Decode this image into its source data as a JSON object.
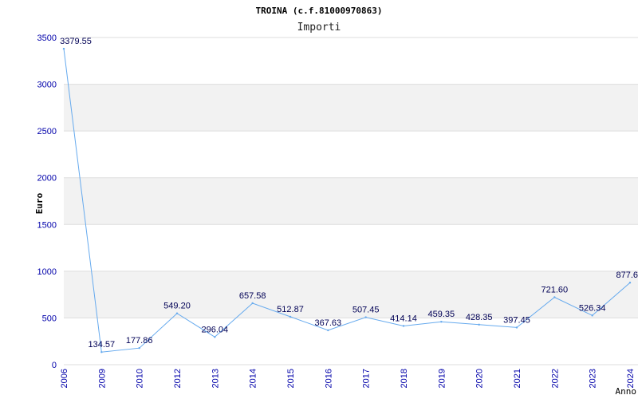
{
  "chart_data": {
    "type": "line",
    "title": "TROINA (c.f.81000970863)",
    "subtitle": "Importi",
    "ylabel": "Euro",
    "xlabel": "Anno",
    "ylim": [
      0,
      3500
    ],
    "y_ticks": [
      "0",
      "500",
      "1000",
      "1500",
      "2000",
      "2500",
      "3000",
      "3500"
    ],
    "grid": "horizontal bands",
    "categories": [
      "2006",
      "2009",
      "2010",
      "2012",
      "2013",
      "2014",
      "2015",
      "2016",
      "2017",
      "2018",
      "2019",
      "2020",
      "2021",
      "2022",
      "2023",
      "2024"
    ],
    "values": [
      3379.55,
      134.57,
      177.86,
      549.2,
      296.04,
      657.58,
      512.87,
      367.63,
      507.45,
      414.14,
      459.35,
      428.35,
      397.45,
      721.6,
      526.34,
      877.6
    ],
    "value_labels": [
      "3379.55",
      "134.57",
      "177.86",
      "549.20",
      "296.04",
      "657.58",
      "512.87",
      "367.63",
      "507.45",
      "414.14",
      "459.35",
      "428.35",
      "397.45",
      "721.60",
      "526.34",
      "877.6"
    ],
    "colors": {
      "line": "#66aaee",
      "band": "#f2f2f2",
      "axis_text": "#0000aa",
      "grid": "#dddddd"
    }
  }
}
